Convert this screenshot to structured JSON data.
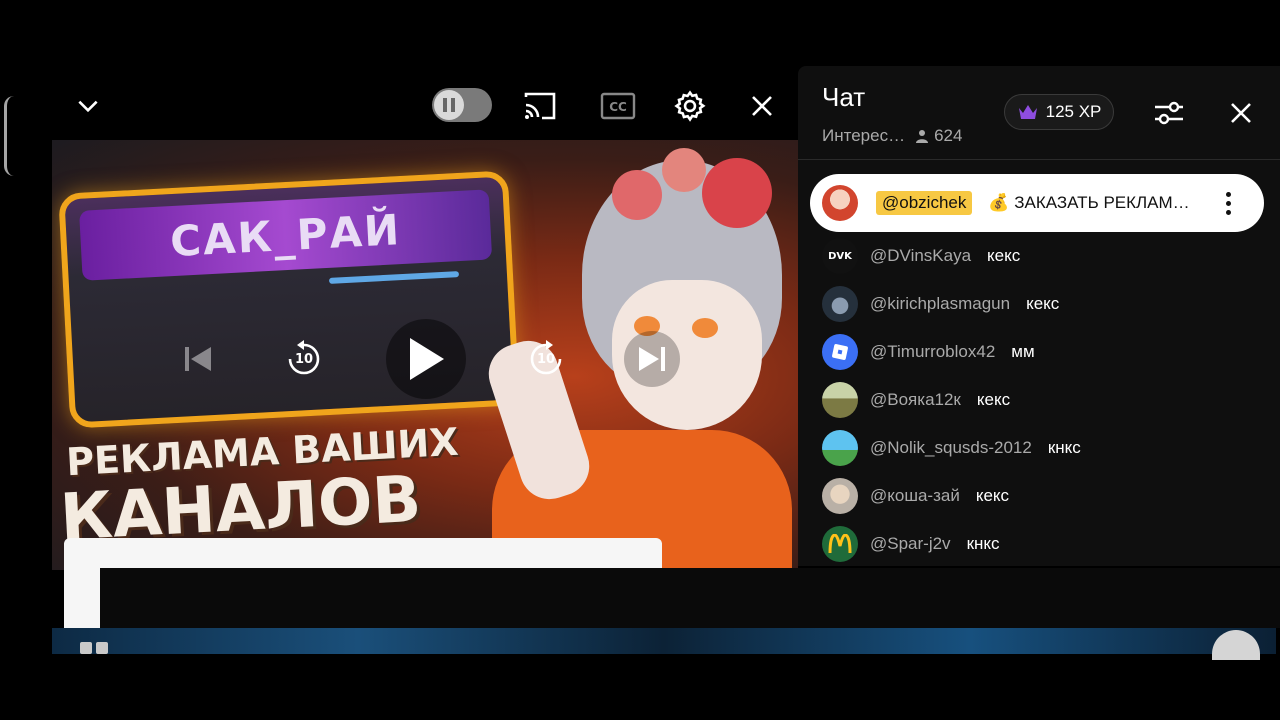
{
  "player": {
    "thumbnail": {
      "banner_text": "САК_РАЙ",
      "headline_line1": "РЕКЛАМА ВАШИХ",
      "headline_line2": "КАНАЛОВ"
    },
    "skip_back_seconds": "10",
    "skip_forward_seconds": "10",
    "icons": {
      "minimize": "chevron-down-icon",
      "autoplay": "pause-icon",
      "cast": "cast-icon",
      "captions": "cc-icon",
      "settings": "gear-icon",
      "close": "close-icon",
      "previous": "skip-previous-icon",
      "rewind": "replay-10-icon",
      "play": "play-icon",
      "forward": "forward-10-icon",
      "next": "skip-next-icon"
    }
  },
  "chat": {
    "title": "Чат",
    "subtitle": "Интерес…",
    "viewer_count": "624",
    "xp_label": "125 XP",
    "colors": {
      "xp_crown": "#8e4de0",
      "pinned_author_bg": "#f7c843"
    },
    "pinned": {
      "author": "@obzichek",
      "text": "💰 ЗАКАЗАТЬ РЕКЛАМ…"
    },
    "messages": [
      {
        "author": "@DVinsKaya",
        "text": "кекс",
        "avatar": "DVK"
      },
      {
        "author": "@kirichplasmagun",
        "text": "кекс",
        "avatar": ""
      },
      {
        "author": "@Timurroblox42",
        "text": "мм",
        "avatar": ""
      },
      {
        "author": "@Вояка12к",
        "text": "кекс",
        "avatar": ""
      },
      {
        "author": "@Nolik_squsds-2012",
        "text": "кнкс",
        "avatar": ""
      },
      {
        "author": "@коша-зай",
        "text": "кекс",
        "avatar": ""
      },
      {
        "author": "@Spar-j2v",
        "text": "кнкс",
        "avatar": ""
      }
    ]
  }
}
